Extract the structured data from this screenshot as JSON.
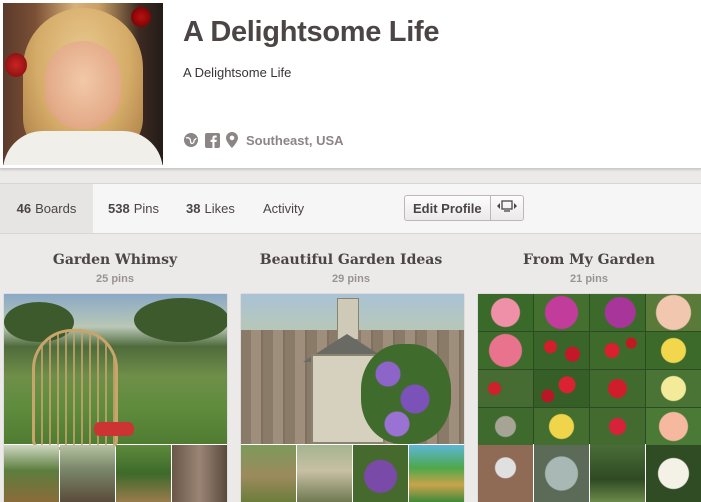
{
  "profile": {
    "name": "A Delightsome Life",
    "about": "A Delightsome Life",
    "location": "Southeast, USA",
    "icons": [
      "globe-icon",
      "facebook-icon",
      "map-pin-icon"
    ]
  },
  "nav": {
    "boards": {
      "count": "46",
      "label": "Boards"
    },
    "pins": {
      "count": "538",
      "label": "Pins"
    },
    "likes": {
      "count": "38",
      "label": "Likes"
    },
    "activity": {
      "label": "Activity"
    },
    "edit_profile": "Edit Profile",
    "reposition_icon": "reposition-cover-icon"
  },
  "boards": [
    {
      "title": "Garden Whimsy",
      "count": "25 pins"
    },
    {
      "title": "Beautiful Garden Ideas",
      "count": "29 pins"
    },
    {
      "title": "From My Garden",
      "count": "21 pins"
    }
  ],
  "colors": {
    "background": "#ece9e9",
    "text_dark": "#4c4545",
    "text_muted": "#8c8585"
  }
}
